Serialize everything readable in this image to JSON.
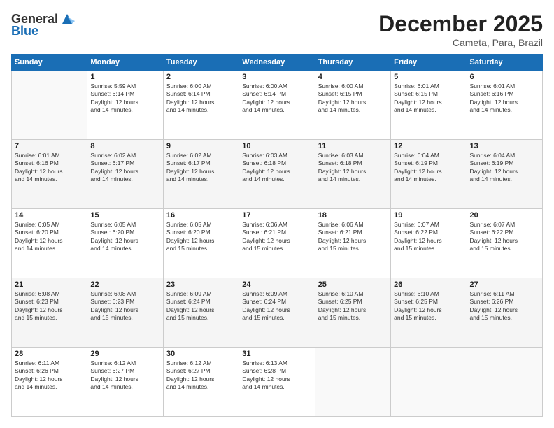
{
  "logo": {
    "general": "General",
    "blue": "Blue"
  },
  "header": {
    "month": "December 2025",
    "location": "Cameta, Para, Brazil"
  },
  "days_of_week": [
    "Sunday",
    "Monday",
    "Tuesday",
    "Wednesday",
    "Thursday",
    "Friday",
    "Saturday"
  ],
  "weeks": [
    [
      {
        "day": "",
        "info": ""
      },
      {
        "day": "1",
        "info": "Sunrise: 5:59 AM\nSunset: 6:14 PM\nDaylight: 12 hours\nand 14 minutes."
      },
      {
        "day": "2",
        "info": "Sunrise: 6:00 AM\nSunset: 6:14 PM\nDaylight: 12 hours\nand 14 minutes."
      },
      {
        "day": "3",
        "info": "Sunrise: 6:00 AM\nSunset: 6:14 PM\nDaylight: 12 hours\nand 14 minutes."
      },
      {
        "day": "4",
        "info": "Sunrise: 6:00 AM\nSunset: 6:15 PM\nDaylight: 12 hours\nand 14 minutes."
      },
      {
        "day": "5",
        "info": "Sunrise: 6:01 AM\nSunset: 6:15 PM\nDaylight: 12 hours\nand 14 minutes."
      },
      {
        "day": "6",
        "info": "Sunrise: 6:01 AM\nSunset: 6:16 PM\nDaylight: 12 hours\nand 14 minutes."
      }
    ],
    [
      {
        "day": "7",
        "info": "Sunrise: 6:01 AM\nSunset: 6:16 PM\nDaylight: 12 hours\nand 14 minutes."
      },
      {
        "day": "8",
        "info": "Sunrise: 6:02 AM\nSunset: 6:17 PM\nDaylight: 12 hours\nand 14 minutes."
      },
      {
        "day": "9",
        "info": "Sunrise: 6:02 AM\nSunset: 6:17 PM\nDaylight: 12 hours\nand 14 minutes."
      },
      {
        "day": "10",
        "info": "Sunrise: 6:03 AM\nSunset: 6:18 PM\nDaylight: 12 hours\nand 14 minutes."
      },
      {
        "day": "11",
        "info": "Sunrise: 6:03 AM\nSunset: 6:18 PM\nDaylight: 12 hours\nand 14 minutes."
      },
      {
        "day": "12",
        "info": "Sunrise: 6:04 AM\nSunset: 6:19 PM\nDaylight: 12 hours\nand 14 minutes."
      },
      {
        "day": "13",
        "info": "Sunrise: 6:04 AM\nSunset: 6:19 PM\nDaylight: 12 hours\nand 14 minutes."
      }
    ],
    [
      {
        "day": "14",
        "info": "Sunrise: 6:05 AM\nSunset: 6:20 PM\nDaylight: 12 hours\nand 14 minutes."
      },
      {
        "day": "15",
        "info": "Sunrise: 6:05 AM\nSunset: 6:20 PM\nDaylight: 12 hours\nand 14 minutes."
      },
      {
        "day": "16",
        "info": "Sunrise: 6:05 AM\nSunset: 6:20 PM\nDaylight: 12 hours\nand 15 minutes."
      },
      {
        "day": "17",
        "info": "Sunrise: 6:06 AM\nSunset: 6:21 PM\nDaylight: 12 hours\nand 15 minutes."
      },
      {
        "day": "18",
        "info": "Sunrise: 6:06 AM\nSunset: 6:21 PM\nDaylight: 12 hours\nand 15 minutes."
      },
      {
        "day": "19",
        "info": "Sunrise: 6:07 AM\nSunset: 6:22 PM\nDaylight: 12 hours\nand 15 minutes."
      },
      {
        "day": "20",
        "info": "Sunrise: 6:07 AM\nSunset: 6:22 PM\nDaylight: 12 hours\nand 15 minutes."
      }
    ],
    [
      {
        "day": "21",
        "info": "Sunrise: 6:08 AM\nSunset: 6:23 PM\nDaylight: 12 hours\nand 15 minutes."
      },
      {
        "day": "22",
        "info": "Sunrise: 6:08 AM\nSunset: 6:23 PM\nDaylight: 12 hours\nand 15 minutes."
      },
      {
        "day": "23",
        "info": "Sunrise: 6:09 AM\nSunset: 6:24 PM\nDaylight: 12 hours\nand 15 minutes."
      },
      {
        "day": "24",
        "info": "Sunrise: 6:09 AM\nSunset: 6:24 PM\nDaylight: 12 hours\nand 15 minutes."
      },
      {
        "day": "25",
        "info": "Sunrise: 6:10 AM\nSunset: 6:25 PM\nDaylight: 12 hours\nand 15 minutes."
      },
      {
        "day": "26",
        "info": "Sunrise: 6:10 AM\nSunset: 6:25 PM\nDaylight: 12 hours\nand 15 minutes."
      },
      {
        "day": "27",
        "info": "Sunrise: 6:11 AM\nSunset: 6:26 PM\nDaylight: 12 hours\nand 15 minutes."
      }
    ],
    [
      {
        "day": "28",
        "info": "Sunrise: 6:11 AM\nSunset: 6:26 PM\nDaylight: 12 hours\nand 14 minutes."
      },
      {
        "day": "29",
        "info": "Sunrise: 6:12 AM\nSunset: 6:27 PM\nDaylight: 12 hours\nand 14 minutes."
      },
      {
        "day": "30",
        "info": "Sunrise: 6:12 AM\nSunset: 6:27 PM\nDaylight: 12 hours\nand 14 minutes."
      },
      {
        "day": "31",
        "info": "Sunrise: 6:13 AM\nSunset: 6:28 PM\nDaylight: 12 hours\nand 14 minutes."
      },
      {
        "day": "",
        "info": ""
      },
      {
        "day": "",
        "info": ""
      },
      {
        "day": "",
        "info": ""
      }
    ]
  ]
}
